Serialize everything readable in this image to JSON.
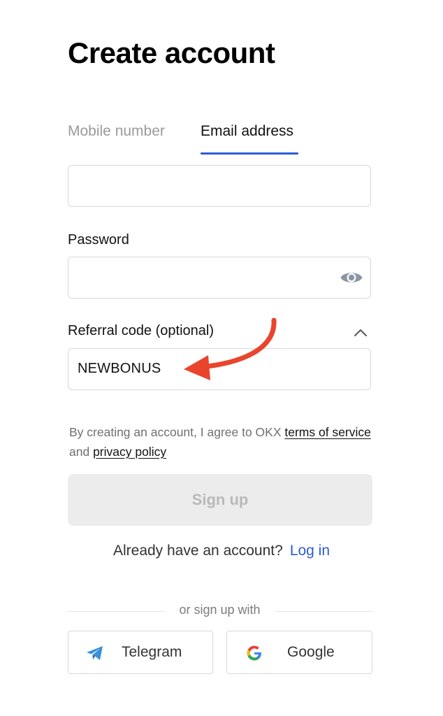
{
  "page": {
    "title": "Create account"
  },
  "tabs": [
    {
      "label": "Mobile number",
      "active": false
    },
    {
      "label": "Email address",
      "active": true
    }
  ],
  "email": {
    "value": ""
  },
  "password": {
    "label": "Password",
    "value": "",
    "icon": "eye-icon"
  },
  "referral": {
    "label": "Referral code (optional)",
    "value": "NEWBONUS",
    "toggle_icon": "chevron-up-icon"
  },
  "terms": {
    "prefix": "By creating an account, I agree to OKX ",
    "terms_link": "terms of service",
    "middle": " and ",
    "privacy_link": "privacy policy"
  },
  "signup": {
    "label": "Sign up",
    "enabled": false
  },
  "login": {
    "prompt": "Already have an account?",
    "link": "Log in"
  },
  "social": {
    "divider_text": "or sign up with",
    "buttons": [
      {
        "label": "Telegram",
        "icon": "telegram-icon"
      },
      {
        "label": "Google",
        "icon": "google-icon"
      }
    ]
  },
  "colors": {
    "accent": "#2f5bd6",
    "annotation_arrow": "#e8452c",
    "disabled_button_bg": "#ececec",
    "disabled_button_text": "#b9b9b9"
  }
}
